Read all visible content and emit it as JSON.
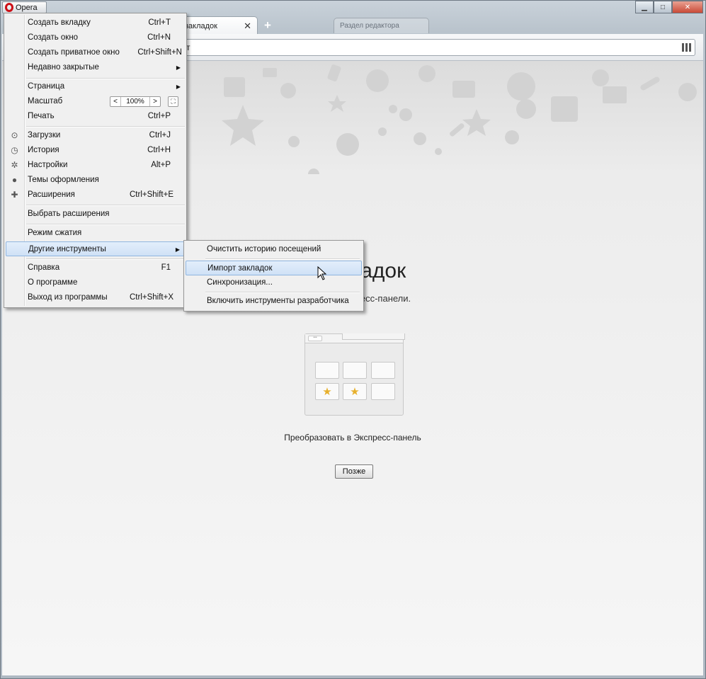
{
  "browser": {
    "menu_button_label": "Opera",
    "active_tab_title": "закладок",
    "inactive_tab_title": "Раздел редактора",
    "address_text": "т",
    "window_controls": [
      "minimize",
      "maximize",
      "close"
    ]
  },
  "page": {
    "heading": "е закладок",
    "subtext": "лементы Экспресс-панели.",
    "convert_label": "Преобразовать в Экспресс-панель",
    "later_button": "Позже",
    "star_color": "#e7b02c"
  },
  "main_menu": {
    "items": [
      {
        "label": "Создать вкладку",
        "shortcut": "Ctrl+T"
      },
      {
        "label": "Создать окно",
        "shortcut": "Ctrl+N"
      },
      {
        "label": "Создать приватное окно",
        "shortcut": "Ctrl+Shift+N"
      },
      {
        "label": "Недавно закрытые",
        "shortcut": ""
      },
      {
        "label": "Страница",
        "shortcut": ""
      },
      {
        "label": "Масштаб",
        "shortcut": ""
      },
      {
        "label": "Печать",
        "shortcut": "Ctrl+P"
      },
      {
        "label": "Загрузки",
        "shortcut": "Ctrl+J"
      },
      {
        "label": "История",
        "shortcut": "Ctrl+H"
      },
      {
        "label": "Настройки",
        "shortcut": "Alt+P"
      },
      {
        "label": "Темы оформления",
        "shortcut": ""
      },
      {
        "label": "Расширения",
        "shortcut": "Ctrl+Shift+E"
      },
      {
        "label": "Выбрать расширения",
        "shortcut": ""
      },
      {
        "label": "Режим сжатия",
        "shortcut": ""
      },
      {
        "label": "Другие инструменты",
        "shortcut": ""
      },
      {
        "label": "Справка",
        "shortcut": "F1"
      },
      {
        "label": "О программе",
        "shortcut": ""
      },
      {
        "label": "Выход из программы",
        "shortcut": "Ctrl+Shift+X"
      }
    ],
    "zoom": {
      "decrease": "<",
      "value": "100%",
      "increase": ">"
    }
  },
  "sub_menu": {
    "items": [
      {
        "label": "Очистить историю посещений"
      },
      {
        "label": "Импорт закладок"
      },
      {
        "label": "Синхронизация..."
      },
      {
        "label": "Включить инструменты разработчика"
      }
    ]
  },
  "colors": {
    "menu_highlight": "#cfe1f6",
    "opera_red": "#cc0f16"
  }
}
